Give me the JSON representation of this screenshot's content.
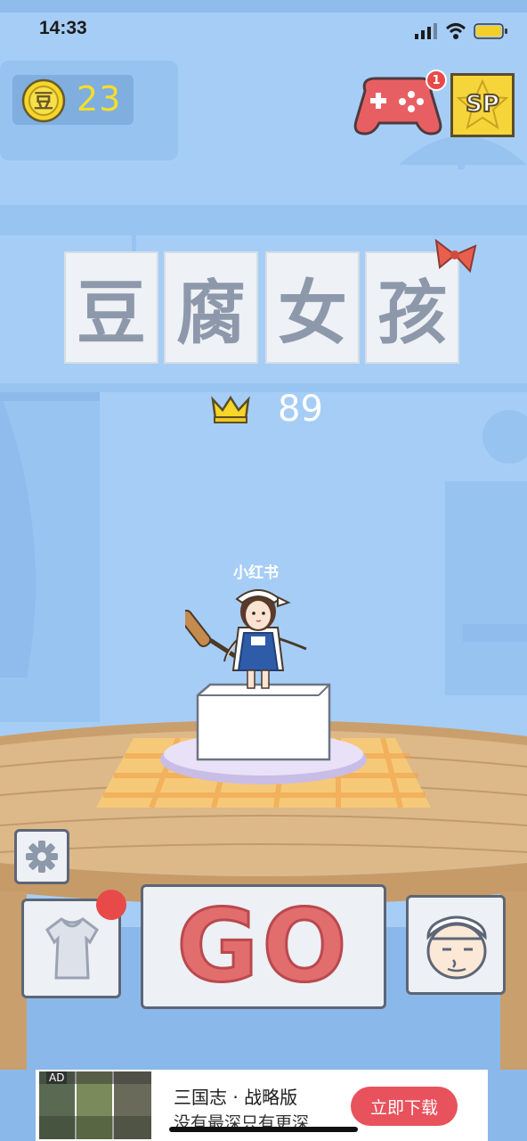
{
  "status_bar": {
    "time": "14:33"
  },
  "hud": {
    "coin_icon_char": "豆",
    "coin_count": "23",
    "gamepad_badge": "1",
    "sp_label": "SP"
  },
  "game": {
    "title_chars": [
      "豆",
      "腐",
      "女",
      "孩"
    ],
    "best_score": "89",
    "watermark": "小红书"
  },
  "controls": {
    "go_label": "GO",
    "has_wardrobe_notification": true
  },
  "ad": {
    "tag": "AD",
    "title": "三国志 · 战略版",
    "subtitle": "没有最深只有更深",
    "button_label": "立即下载"
  },
  "colors": {
    "background": "#a6cdf6",
    "coin_yellow": "#f5dd2a",
    "go_red": "#e26d6d",
    "ad_button": "#e8525d",
    "badge_red": "#e84a4a"
  },
  "icons": [
    "signal-icon",
    "wifi-icon",
    "battery-icon",
    "coin-icon",
    "gamepad-icon",
    "sp-star-icon",
    "crown-icon",
    "gear-icon",
    "dress-icon",
    "chef-face-icon"
  ]
}
